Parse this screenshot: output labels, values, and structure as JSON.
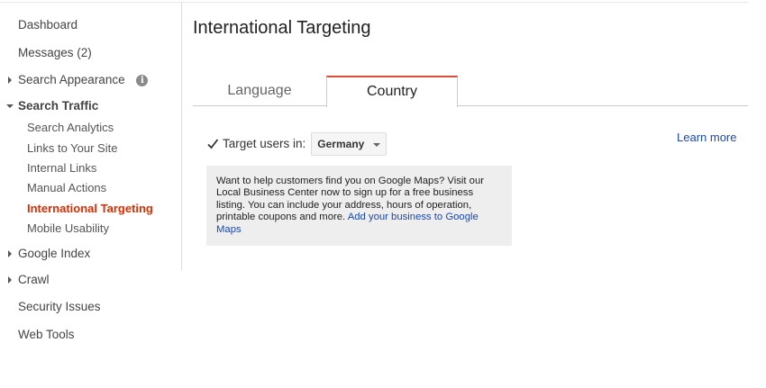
{
  "sidebar": {
    "dashboard": "Dashboard",
    "messages": "Messages (2)",
    "search_appearance": "Search Appearance",
    "search_traffic": "Search Traffic",
    "search_traffic_items": {
      "search_analytics": "Search Analytics",
      "links_to_your_site": "Links to Your Site",
      "internal_links": "Internal Links",
      "manual_actions": "Manual Actions",
      "international_targeting": "International Targeting",
      "mobile_usability": "Mobile Usability"
    },
    "google_index": "Google Index",
    "crawl": "Crawl",
    "security_issues": "Security Issues",
    "web_tools": "Web Tools",
    "info_icon_glyph": "i"
  },
  "main": {
    "title": "International Targeting",
    "tabs": [
      {
        "label": "Language",
        "active": false
      },
      {
        "label": "Country",
        "active": true
      }
    ],
    "target_label": "Target users in:",
    "target_checked": true,
    "country_selected": "Germany",
    "learn_more": "Learn more",
    "info_text": "Want to help customers find you on Google Maps? Visit our Local Business Center now to sign up for a free business listing. You can include your address, hours of operation, printable coupons and more. ",
    "info_link": "Add your business to Google Maps"
  },
  "colors": {
    "active_nav": "#dd2c00",
    "active_tab_border": "#dd4b39",
    "link": "#1a48b0",
    "panel_bg": "#eeeeee"
  }
}
